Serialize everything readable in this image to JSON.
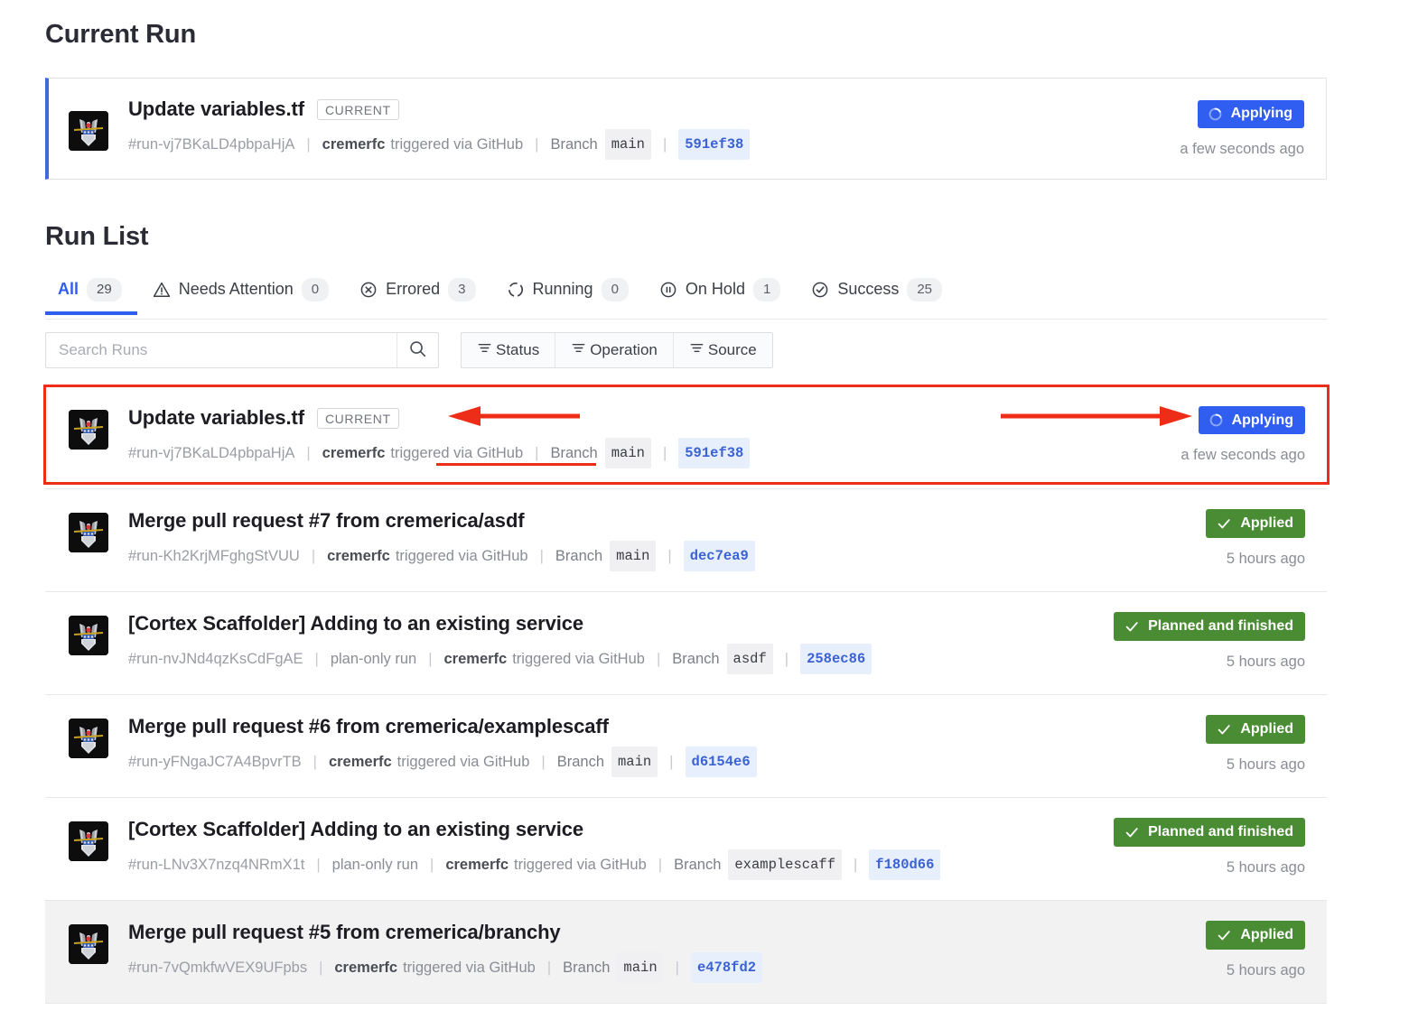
{
  "headings": {
    "current_run": "Current Run",
    "run_list": "Run List"
  },
  "colors": {
    "accent_blue": "#2f5ef0",
    "current_border": "#3f6bd8",
    "success_green": "#4a8c34",
    "annotation_red": "#ee2d18",
    "sha_text": "#3b62d4",
    "sha_bg": "#e8effc"
  },
  "current_run": {
    "title": "Update variables.tf",
    "chip": "CURRENT",
    "run_id": "#run-vj7BKaLD4pbpaHjA",
    "user": "cremerfc",
    "trigger": "triggered via GitHub",
    "branch_label": "Branch",
    "branch": "main",
    "sha": "591ef38",
    "status": "Applying",
    "timestamp": "a few seconds ago"
  },
  "tabs": [
    {
      "label": "All",
      "count": "29",
      "icon": "none",
      "active": true
    },
    {
      "label": "Needs Attention",
      "count": "0",
      "icon": "warning-triangle-icon",
      "active": false
    },
    {
      "label": "Errored",
      "count": "3",
      "icon": "error-x-circle-icon",
      "active": false
    },
    {
      "label": "Running",
      "count": "0",
      "icon": "running-spinner-icon",
      "active": false
    },
    {
      "label": "On Hold",
      "count": "1",
      "icon": "pause-circle-icon",
      "active": false
    },
    {
      "label": "Success",
      "count": "25",
      "icon": "check-circle-icon",
      "active": false
    }
  ],
  "search": {
    "placeholder": "Search Runs",
    "value": ""
  },
  "filters": [
    {
      "label": "Status"
    },
    {
      "label": "Operation"
    },
    {
      "label": "Source"
    }
  ],
  "runs": [
    {
      "title": "Update variables.tf",
      "chip": "CURRENT",
      "run_id": "#run-vj7BKaLD4pbpaHjA",
      "plan_only": "",
      "user": "cremerfc",
      "trigger": "triggered via GitHub",
      "branch_label": "Branch",
      "branch": "main",
      "sha": "591ef38",
      "status": "Applying",
      "status_kind": "applying",
      "timestamp": "a few seconds ago",
      "highlighted": true,
      "hovered": false
    },
    {
      "title": "Merge pull request #7 from cremerica/asdf",
      "chip": "",
      "run_id": "#run-Kh2KrjMFghgStVUU",
      "plan_only": "",
      "user": "cremerfc",
      "trigger": "triggered via GitHub",
      "branch_label": "Branch",
      "branch": "main",
      "sha": "dec7ea9",
      "status": "Applied",
      "status_kind": "green",
      "timestamp": "5 hours ago",
      "highlighted": false,
      "hovered": false
    },
    {
      "title": "[Cortex Scaffolder] Adding to an existing service",
      "chip": "",
      "run_id": "#run-nvJNd4qzKsCdFgAE",
      "plan_only": "plan-only run",
      "user": "cremerfc",
      "trigger": "triggered via GitHub",
      "branch_label": "Branch",
      "branch": "asdf",
      "sha": "258ec86",
      "status": "Planned and finished",
      "status_kind": "green",
      "timestamp": "5 hours ago",
      "highlighted": false,
      "hovered": false
    },
    {
      "title": "Merge pull request #6 from cremerica/examplescaff",
      "chip": "",
      "run_id": "#run-yFNgaJC7A4BpvrTB",
      "plan_only": "",
      "user": "cremerfc",
      "trigger": "triggered via GitHub",
      "branch_label": "Branch",
      "branch": "main",
      "sha": "d6154e6",
      "status": "Applied",
      "status_kind": "green",
      "timestamp": "5 hours ago",
      "highlighted": false,
      "hovered": false
    },
    {
      "title": "[Cortex Scaffolder] Adding to an existing service",
      "chip": "",
      "run_id": "#run-LNv3X7nzq4NRmX1t",
      "plan_only": "plan-only run",
      "user": "cremerfc",
      "trigger": "triggered via GitHub",
      "branch_label": "Branch",
      "branch": "examplescaff",
      "sha": "f180d66",
      "status": "Planned and finished",
      "status_kind": "green",
      "timestamp": "5 hours ago",
      "highlighted": false,
      "hovered": false
    },
    {
      "title": "Merge pull request #5 from cremerica/branchy",
      "chip": "",
      "run_id": "#run-7vQmkfwVEX9UFpbs",
      "plan_only": "",
      "user": "cremerfc",
      "trigger": "triggered via GitHub",
      "branch_label": "Branch",
      "branch": "main",
      "sha": "e478fd2",
      "status": "Applied",
      "status_kind": "green",
      "timestamp": "5 hours ago",
      "highlighted": false,
      "hovered": true
    }
  ],
  "annotations": {
    "arrow_to_current_chip": "arrow pointing left at CURRENT badge",
    "arrow_to_status": "arrow pointing right at Applying badge",
    "underline_trigger": "red underline under triggered via GitHub",
    "box_around_row": "red box around first run row"
  }
}
